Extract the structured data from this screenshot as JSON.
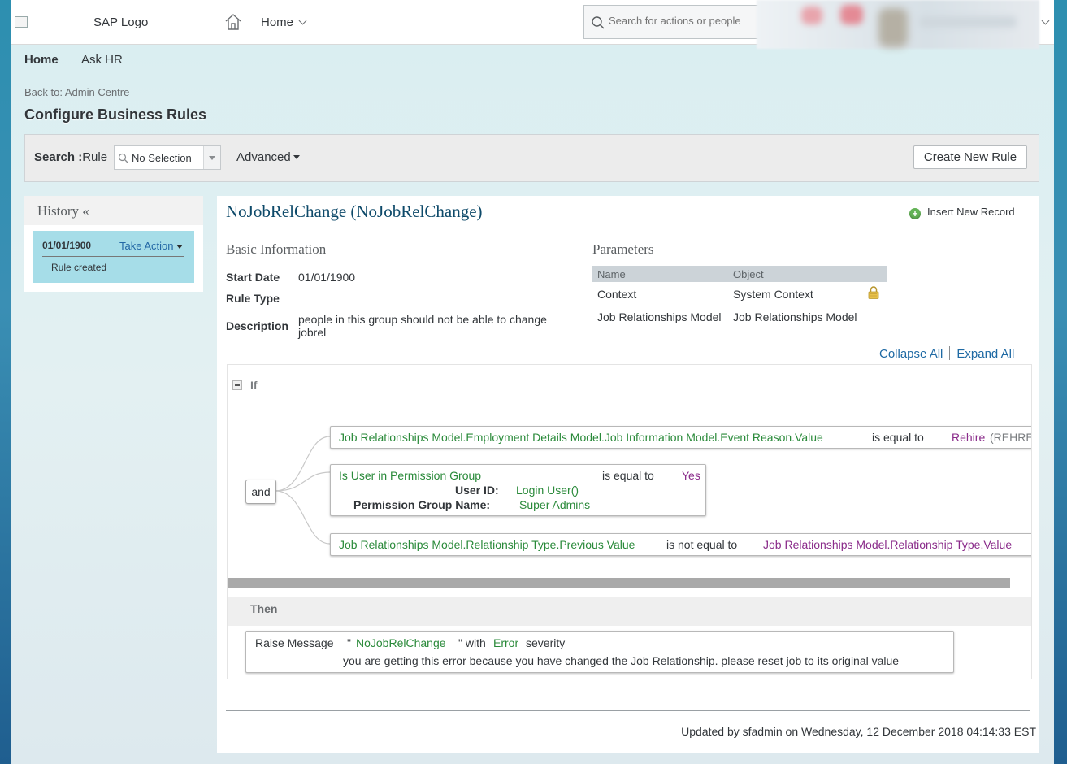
{
  "shell": {
    "logo_text": "SAP Logo",
    "home_menu": "Home",
    "search_placeholder": "Search for actions or people"
  },
  "subnav": {
    "home": "Home",
    "ask_hr": "Ask HR"
  },
  "back_link": "Back to: Admin Centre",
  "page_title": "Configure Business Rules",
  "searchbar": {
    "label_bold": "Search :",
    "label_plain": "Rule",
    "select_value": "No Selection",
    "advanced": "Advanced",
    "create_button": "Create New Rule"
  },
  "history": {
    "title": "History «",
    "items": [
      {
        "date": "01/01/1900",
        "action": "Take Action",
        "description": "Rule created"
      }
    ]
  },
  "rule": {
    "title": "NoJobRelChange (NoJobRelChange)",
    "insert_record": "Insert New Record",
    "basic_info_title": "Basic Information",
    "fields": {
      "start_date_label": "Start Date",
      "start_date_value": "01/01/1900",
      "rule_type_label": "Rule Type",
      "rule_type_value": "",
      "description_label": "Description",
      "description_line1": "people in this group should not be able to change",
      "description_line2": "jobrel"
    },
    "parameters_title": "Parameters",
    "parameters": {
      "headers": [
        "Name",
        "Object"
      ],
      "rows": [
        {
          "name": "Context",
          "object": "System Context",
          "locked": true
        },
        {
          "name": "Job Relationships Model",
          "object": "Job Relationships Model",
          "locked": false
        }
      ]
    },
    "collapse_all": "Collapse All",
    "expand_all": "Expand All"
  },
  "if_block": {
    "label": "If",
    "operator": "and",
    "conditions": [
      {
        "left": "Job Relationships Model.Employment Details Model.Job Information Model.Event Reason.Value",
        "op": "is equal to",
        "right": "Rehire",
        "right_extra": "(REHRE"
      },
      {
        "left": "Is User in Permission Group",
        "op": "is equal to",
        "right": "Yes",
        "param1_label": "User ID:",
        "param1_value": "Login User()",
        "param2_label": "Permission Group Name:",
        "param2_value": "Super Admins"
      },
      {
        "left": "Job Relationships Model.Relationship Type.Previous Value",
        "op": "is not equal to",
        "right": "Job Relationships Model.Relationship Type.Value"
      }
    ]
  },
  "then_block": {
    "label": "Then",
    "action": "Raise Message",
    "quote_open": "\"",
    "message_key": "NoJobRelChange",
    "quote_close": "\" with",
    "severity": "Error",
    "severity_suffix": "severity",
    "message_text": "you are getting this error because you have changed the Job Relationship. please reset job to its original value"
  },
  "footer": {
    "updated": "Updated by sfadmin on Wednesday, 12 December 2018 04:14:33 EST"
  },
  "colors": {
    "link": "#1f6aa4",
    "rule_green": "#2a8a3a",
    "rule_purple": "#8a2b8a",
    "history_highlight": "#a6dde8"
  }
}
